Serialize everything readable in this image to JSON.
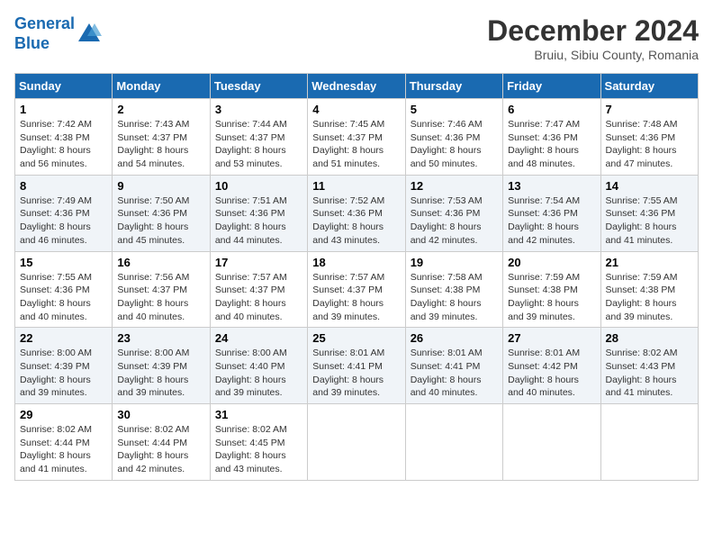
{
  "header": {
    "logo_line1": "General",
    "logo_line2": "Blue",
    "month_title": "December 2024",
    "subtitle": "Bruiu, Sibiu County, Romania"
  },
  "days_of_week": [
    "Sunday",
    "Monday",
    "Tuesday",
    "Wednesday",
    "Thursday",
    "Friday",
    "Saturday"
  ],
  "weeks": [
    [
      {
        "day": "1",
        "info": "Sunrise: 7:42 AM\nSunset: 4:38 PM\nDaylight: 8 hours and 56 minutes."
      },
      {
        "day": "2",
        "info": "Sunrise: 7:43 AM\nSunset: 4:37 PM\nDaylight: 8 hours and 54 minutes."
      },
      {
        "day": "3",
        "info": "Sunrise: 7:44 AM\nSunset: 4:37 PM\nDaylight: 8 hours and 53 minutes."
      },
      {
        "day": "4",
        "info": "Sunrise: 7:45 AM\nSunset: 4:37 PM\nDaylight: 8 hours and 51 minutes."
      },
      {
        "day": "5",
        "info": "Sunrise: 7:46 AM\nSunset: 4:36 PM\nDaylight: 8 hours and 50 minutes."
      },
      {
        "day": "6",
        "info": "Sunrise: 7:47 AM\nSunset: 4:36 PM\nDaylight: 8 hours and 48 minutes."
      },
      {
        "day": "7",
        "info": "Sunrise: 7:48 AM\nSunset: 4:36 PM\nDaylight: 8 hours and 47 minutes."
      }
    ],
    [
      {
        "day": "8",
        "info": "Sunrise: 7:49 AM\nSunset: 4:36 PM\nDaylight: 8 hours and 46 minutes."
      },
      {
        "day": "9",
        "info": "Sunrise: 7:50 AM\nSunset: 4:36 PM\nDaylight: 8 hours and 45 minutes."
      },
      {
        "day": "10",
        "info": "Sunrise: 7:51 AM\nSunset: 4:36 PM\nDaylight: 8 hours and 44 minutes."
      },
      {
        "day": "11",
        "info": "Sunrise: 7:52 AM\nSunset: 4:36 PM\nDaylight: 8 hours and 43 minutes."
      },
      {
        "day": "12",
        "info": "Sunrise: 7:53 AM\nSunset: 4:36 PM\nDaylight: 8 hours and 42 minutes."
      },
      {
        "day": "13",
        "info": "Sunrise: 7:54 AM\nSunset: 4:36 PM\nDaylight: 8 hours and 42 minutes."
      },
      {
        "day": "14",
        "info": "Sunrise: 7:55 AM\nSunset: 4:36 PM\nDaylight: 8 hours and 41 minutes."
      }
    ],
    [
      {
        "day": "15",
        "info": "Sunrise: 7:55 AM\nSunset: 4:36 PM\nDaylight: 8 hours and 40 minutes."
      },
      {
        "day": "16",
        "info": "Sunrise: 7:56 AM\nSunset: 4:37 PM\nDaylight: 8 hours and 40 minutes."
      },
      {
        "day": "17",
        "info": "Sunrise: 7:57 AM\nSunset: 4:37 PM\nDaylight: 8 hours and 40 minutes."
      },
      {
        "day": "18",
        "info": "Sunrise: 7:57 AM\nSunset: 4:37 PM\nDaylight: 8 hours and 39 minutes."
      },
      {
        "day": "19",
        "info": "Sunrise: 7:58 AM\nSunset: 4:38 PM\nDaylight: 8 hours and 39 minutes."
      },
      {
        "day": "20",
        "info": "Sunrise: 7:59 AM\nSunset: 4:38 PM\nDaylight: 8 hours and 39 minutes."
      },
      {
        "day": "21",
        "info": "Sunrise: 7:59 AM\nSunset: 4:38 PM\nDaylight: 8 hours and 39 minutes."
      }
    ],
    [
      {
        "day": "22",
        "info": "Sunrise: 8:00 AM\nSunset: 4:39 PM\nDaylight: 8 hours and 39 minutes."
      },
      {
        "day": "23",
        "info": "Sunrise: 8:00 AM\nSunset: 4:39 PM\nDaylight: 8 hours and 39 minutes."
      },
      {
        "day": "24",
        "info": "Sunrise: 8:00 AM\nSunset: 4:40 PM\nDaylight: 8 hours and 39 minutes."
      },
      {
        "day": "25",
        "info": "Sunrise: 8:01 AM\nSunset: 4:41 PM\nDaylight: 8 hours and 39 minutes."
      },
      {
        "day": "26",
        "info": "Sunrise: 8:01 AM\nSunset: 4:41 PM\nDaylight: 8 hours and 40 minutes."
      },
      {
        "day": "27",
        "info": "Sunrise: 8:01 AM\nSunset: 4:42 PM\nDaylight: 8 hours and 40 minutes."
      },
      {
        "day": "28",
        "info": "Sunrise: 8:02 AM\nSunset: 4:43 PM\nDaylight: 8 hours and 41 minutes."
      }
    ],
    [
      {
        "day": "29",
        "info": "Sunrise: 8:02 AM\nSunset: 4:44 PM\nDaylight: 8 hours and 41 minutes."
      },
      {
        "day": "30",
        "info": "Sunrise: 8:02 AM\nSunset: 4:44 PM\nDaylight: 8 hours and 42 minutes."
      },
      {
        "day": "31",
        "info": "Sunrise: 8:02 AM\nSunset: 4:45 PM\nDaylight: 8 hours and 43 minutes."
      },
      null,
      null,
      null,
      null
    ]
  ]
}
